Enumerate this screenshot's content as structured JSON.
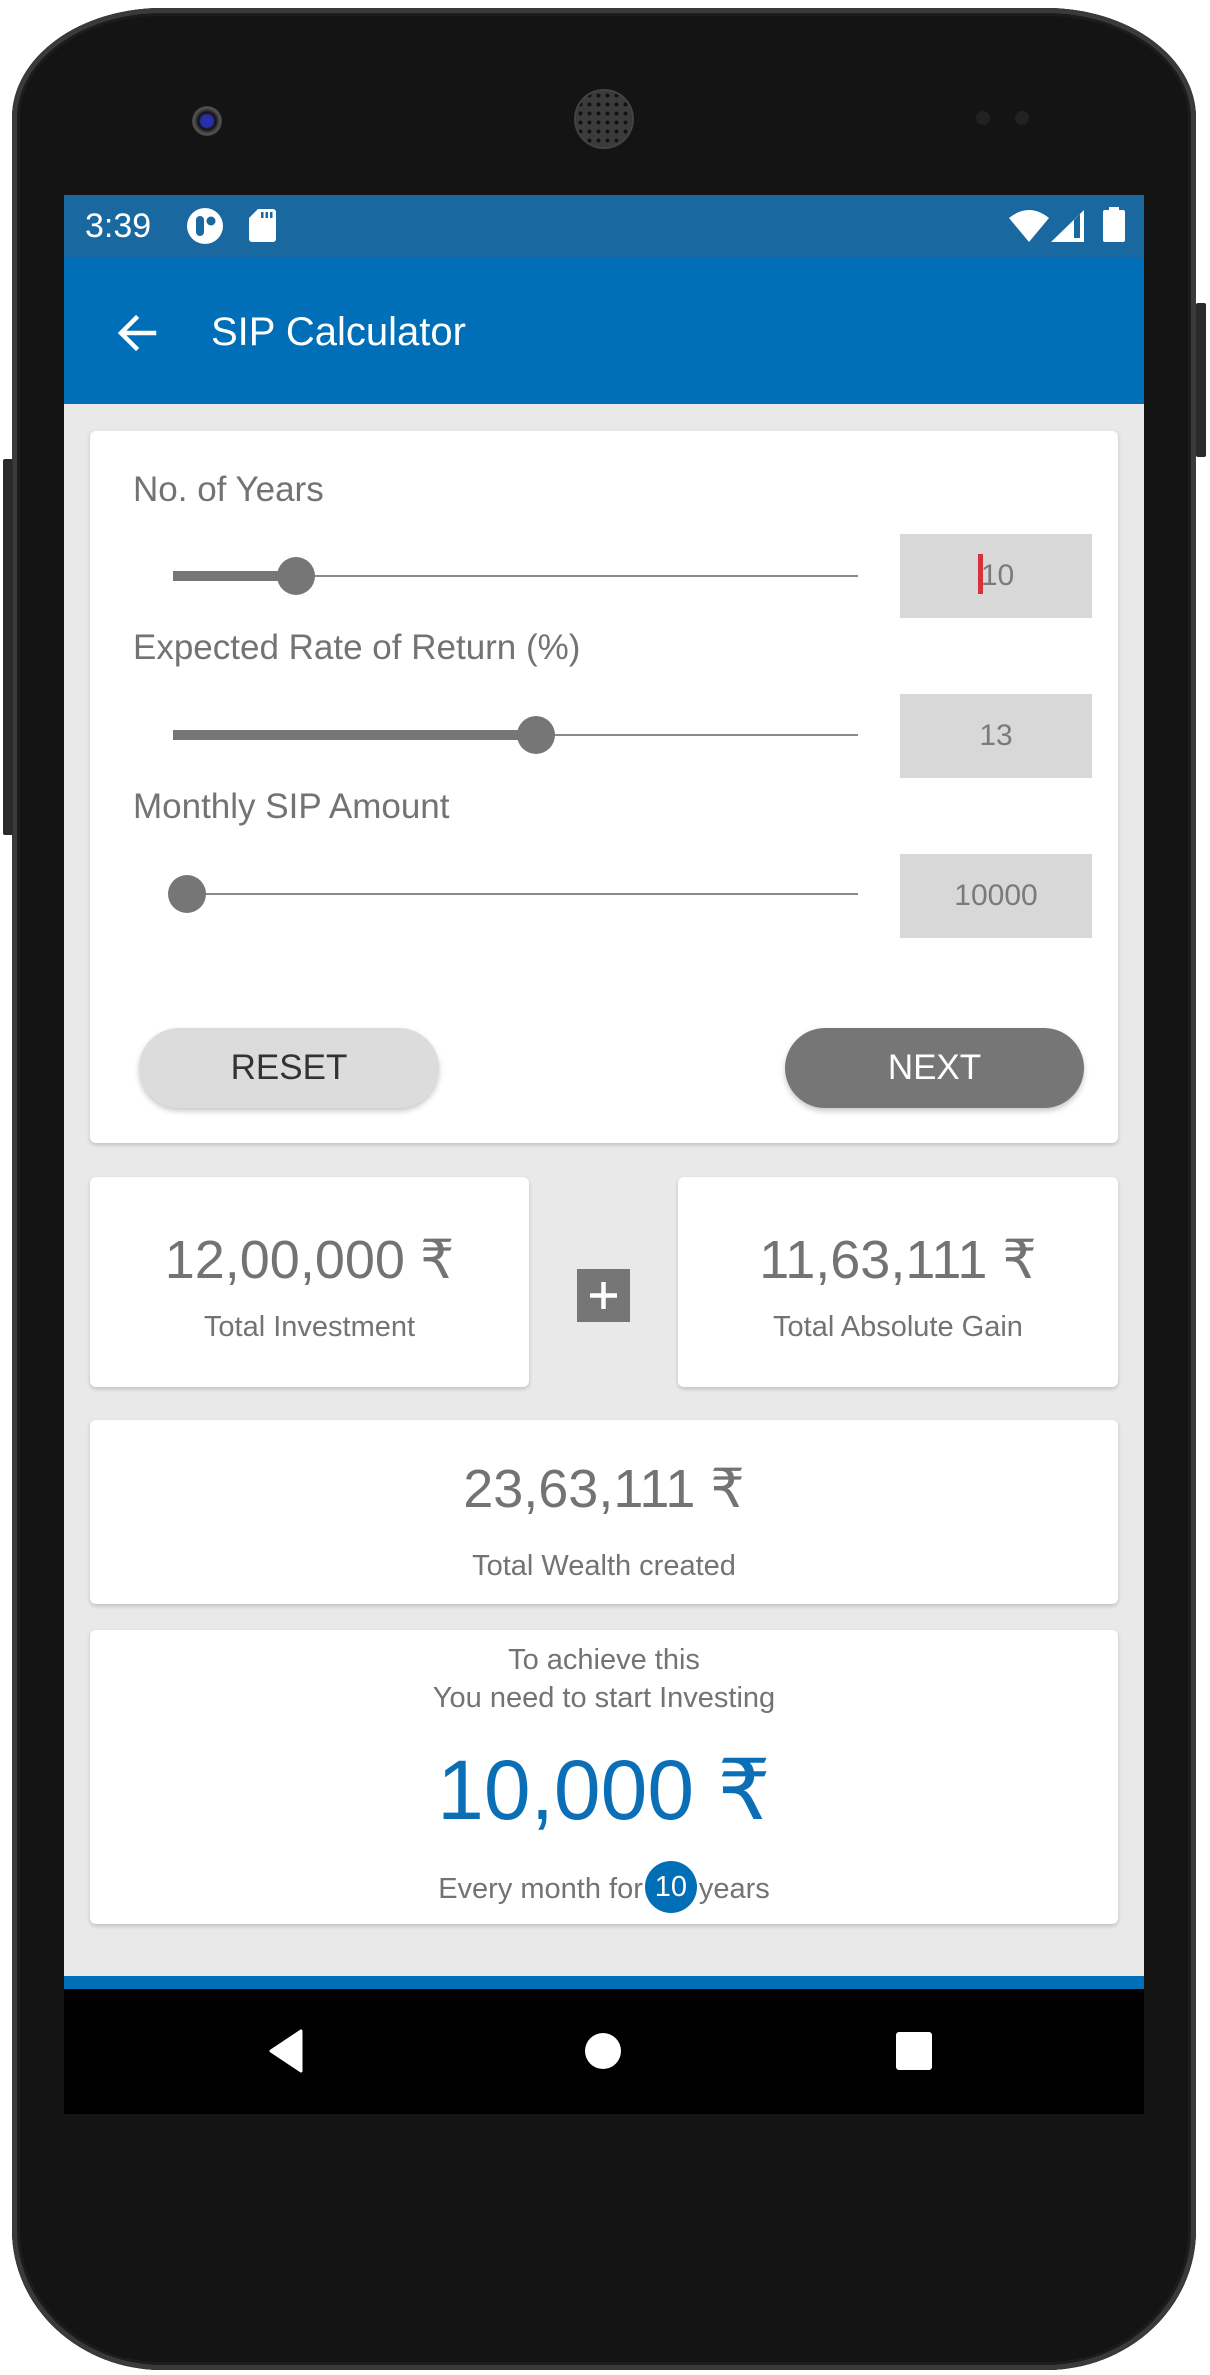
{
  "device": {
    "status_bar": {
      "time": "3:39",
      "left_icons": [
        "notification-circle-icon",
        "sd-card-icon"
      ],
      "right_icons": [
        "wifi-icon",
        "cell-signal-icon",
        "battery-icon"
      ]
    },
    "nav_bar": {
      "buttons": [
        "back",
        "home",
        "recents"
      ]
    }
  },
  "app_bar": {
    "title": "SIP Calculator",
    "back_icon": "arrow-left-icon"
  },
  "inputs": [
    {
      "label": "No. of Years",
      "value": "10",
      "slider_fraction": 0.18,
      "focused": true
    },
    {
      "label": "Expected Rate of Return (%)",
      "value": "13",
      "slider_fraction": 0.53,
      "focused": false
    },
    {
      "label": "Monthly SIP Amount",
      "value": "10000",
      "slider_fraction": 0.02,
      "focused": false
    }
  ],
  "buttons": {
    "reset": "RESET",
    "next": "NEXT"
  },
  "results": {
    "investment": {
      "amount": "12,00,000 ₹",
      "label": "Total Investment"
    },
    "operator_icon": "plus-icon",
    "gain": {
      "amount": "11,63,111 ₹",
      "label": "Total Absolute Gain"
    },
    "wealth": {
      "amount": "23,63,111 ₹",
      "label": "Total Wealth created"
    }
  },
  "goal": {
    "line1": "To achieve this",
    "line2": "You need to start Investing",
    "amount": "10,000 ₹",
    "prefix": "Every month for",
    "years": "10",
    "suffix": "years"
  },
  "colors": {
    "primary": "#016fb7",
    "status_bar": "#1a68a0",
    "slider": "#767676",
    "caret": "#d6323e",
    "background": "#e9e9e9"
  }
}
